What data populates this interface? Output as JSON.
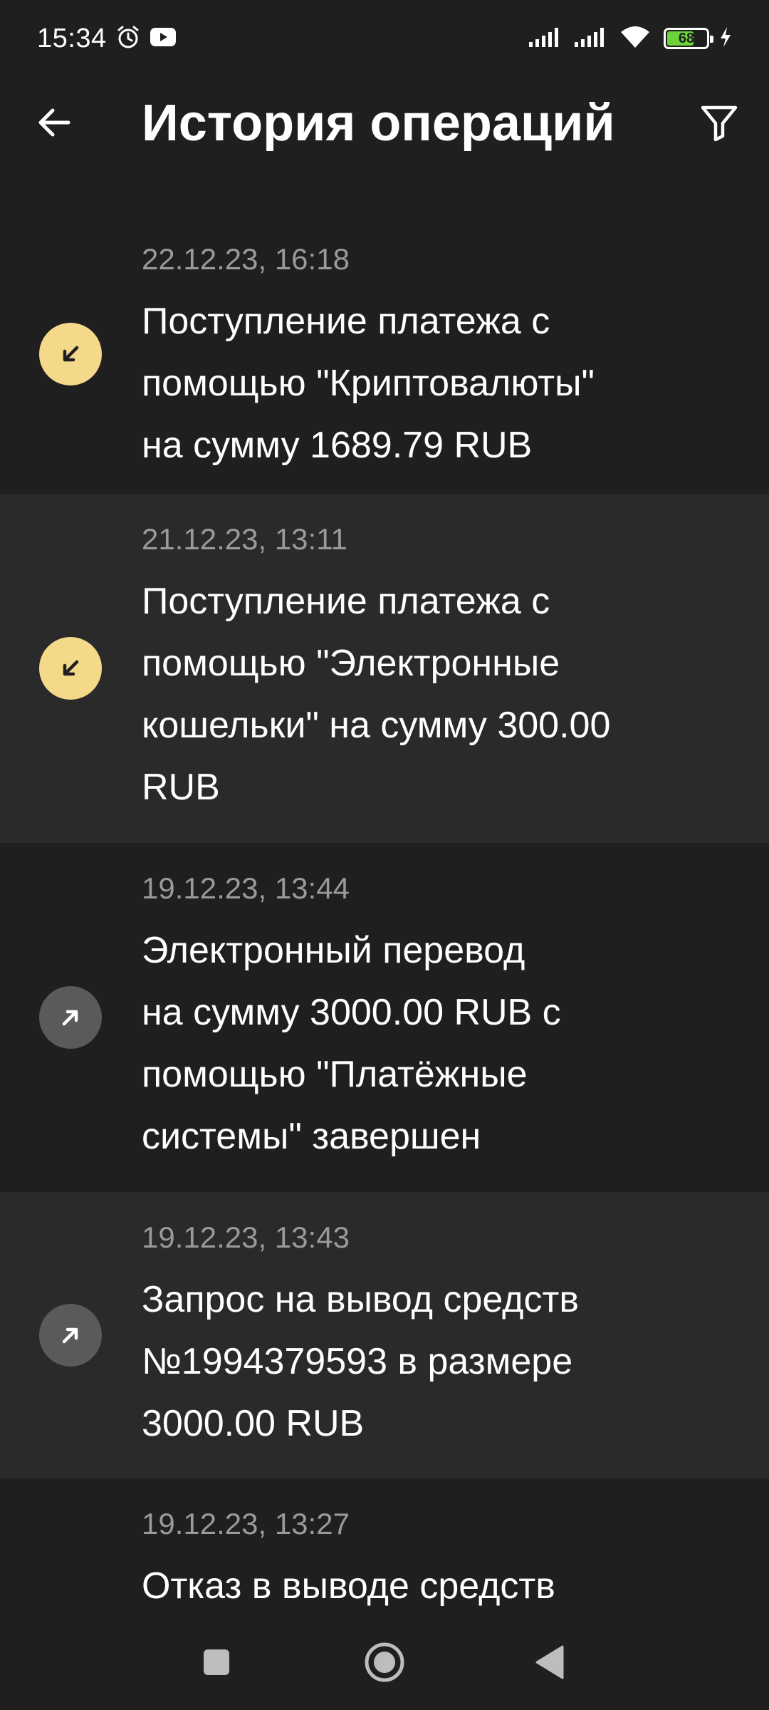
{
  "status_bar": {
    "time": "15:34",
    "battery_level": 68,
    "battery_text": "68",
    "icons": [
      "alarm-icon",
      "youtube-icon",
      "signal-icon",
      "signal-icon",
      "wifi-icon",
      "battery-icon",
      "charging-icon"
    ]
  },
  "header": {
    "title": "История операций",
    "back_icon": "arrow-left-icon",
    "filter_icon": "filter-icon"
  },
  "operations": [
    {
      "date": "22.12.23, 16:18",
      "description": "Поступление платежа с\nпомощью \"Криптовалюты\"\nна сумму 1689.79 RUB",
      "direction": "incoming",
      "icon_color": "#f5d98a"
    },
    {
      "date": "21.12.23, 13:11",
      "description": "Поступление платежа с\nпомощью \"Электронные\nкошельки\" на сумму 300.00\nRUB",
      "direction": "incoming",
      "icon_color": "#f5d98a"
    },
    {
      "date": "19.12.23, 13:44",
      "description": "Электронный перевод\nна сумму 3000.00 RUB с\nпомощью \"Платёжные\nсистемы\" завершен",
      "direction": "outgoing",
      "icon_color": "#5a5a5a"
    },
    {
      "date": "19.12.23, 13:43",
      "description": "Запрос на вывод средств\n№1994379593 в размере\n3000.00 RUB",
      "direction": "outgoing",
      "icon_color": "#5a5a5a"
    },
    {
      "date": "19.12.23, 13:27",
      "description": "Отказ в выводе средств",
      "direction": "none"
    }
  ],
  "nav_bar": {
    "buttons": [
      "recents-square-icon",
      "home-circle-icon",
      "back-triangle-icon"
    ]
  },
  "colors": {
    "background": "#1f1f1f",
    "row_alt": "#2a2a2a",
    "incoming_accent": "#f5d98a",
    "outgoing_accent": "#5a5a5a",
    "secondary_text": "#9a9a9a"
  }
}
